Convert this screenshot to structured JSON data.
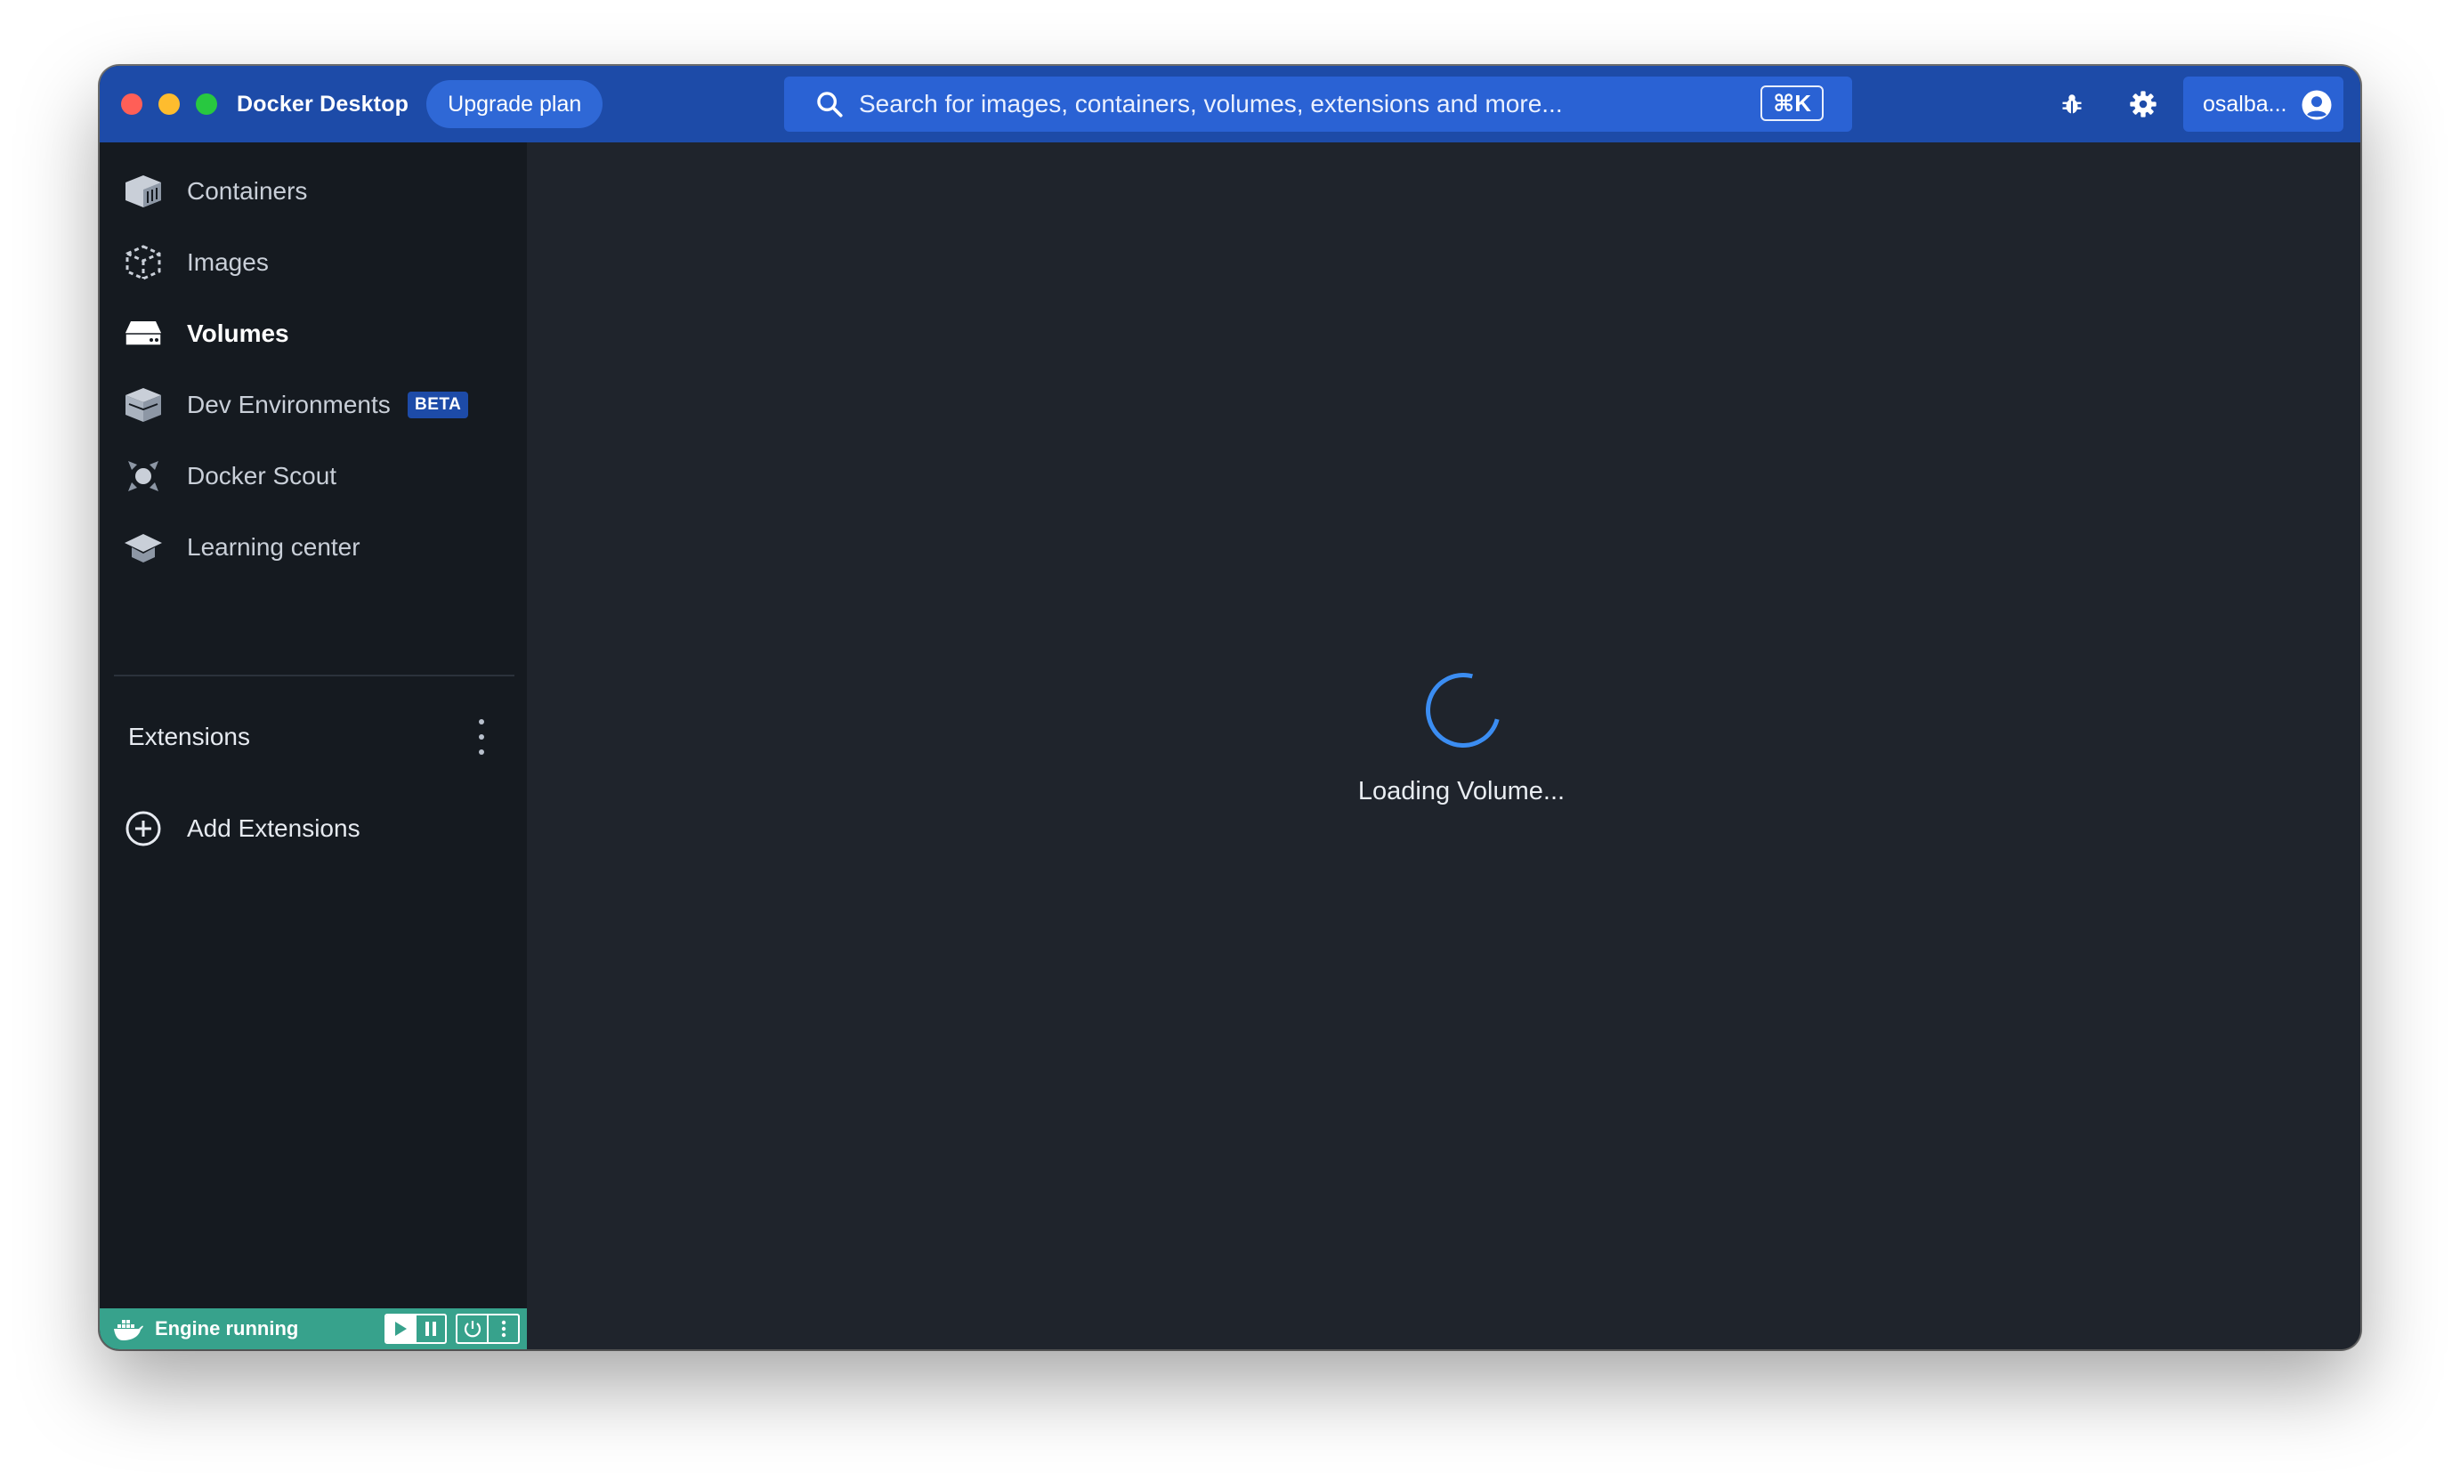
{
  "titlebar": {
    "app_title": "Docker Desktop",
    "upgrade_label": "Upgrade plan",
    "search_placeholder": "Search for images, containers, volumes, extensions and more...",
    "search_shortcut": "⌘K",
    "account_name": "osalba...",
    "icons": [
      "search-icon",
      "bug-icon",
      "gear-icon",
      "account-icon"
    ]
  },
  "sidebar": {
    "items": [
      {
        "label": "Containers",
        "icon": "containers-icon"
      },
      {
        "label": "Images",
        "icon": "images-icon"
      },
      {
        "label": "Volumes",
        "icon": "volumes-icon",
        "active": true
      },
      {
        "label": "Dev Environments",
        "icon": "dev-environments-icon",
        "badge": "BETA"
      },
      {
        "label": "Docker Scout",
        "icon": "docker-scout-icon"
      },
      {
        "label": "Learning center",
        "icon": "learning-center-icon"
      }
    ],
    "extensions_label": "Extensions",
    "add_extensions_label": "Add Extensions"
  },
  "footer": {
    "engine_status": "Engine running"
  },
  "main": {
    "loading_text": "Loading Volume..."
  },
  "colors": {
    "titlebar": "#1d4ba8",
    "sidebar": "#151a20",
    "main": "#1f242c",
    "footer_status": "#37a28c",
    "accent": "#3b8df2"
  }
}
